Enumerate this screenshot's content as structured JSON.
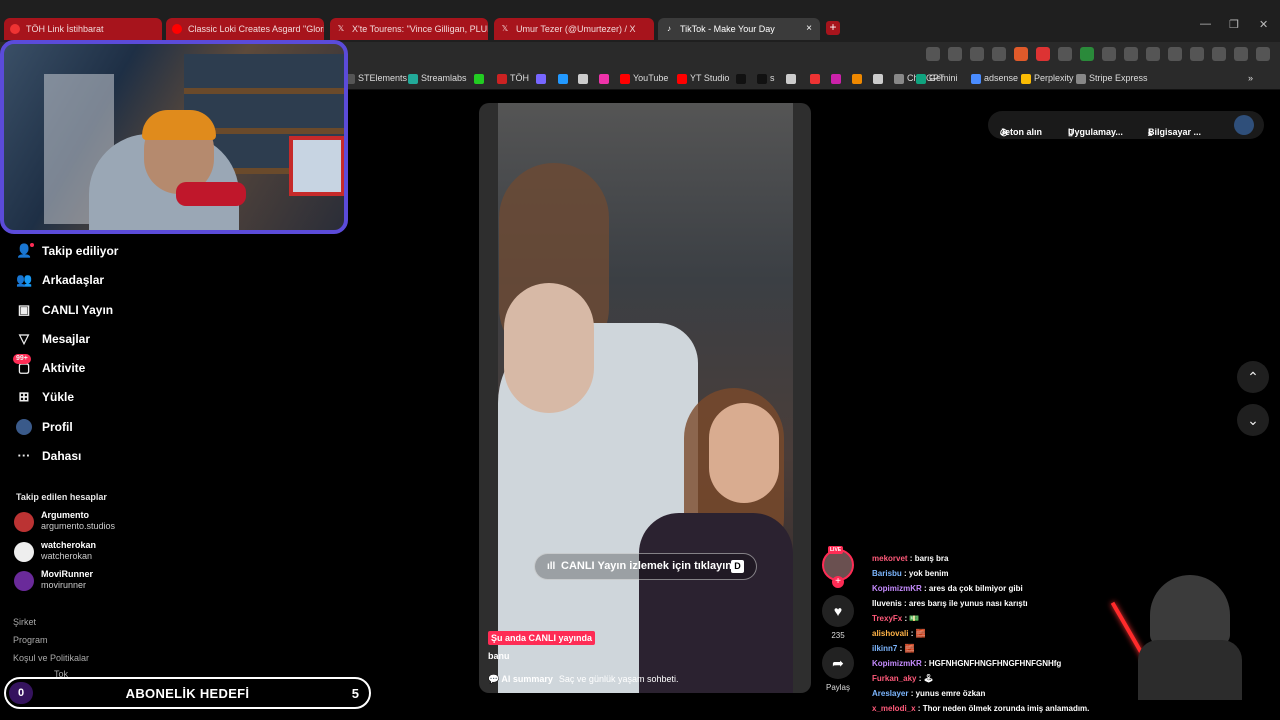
{
  "browser": {
    "tabs": [
      {
        "title": "TÖH Link İstihbarat",
        "icon": "toh-icon"
      },
      {
        "title": "Classic Loki Creates Asgard \"Glorious",
        "icon": "youtube-icon"
      },
      {
        "title": "X'te Tourens: \"Vince Gilligan, PLURIB",
        "icon": "x-icon"
      },
      {
        "title": "Umur Tezer (@Umurtezer) / X",
        "icon": "x-icon"
      },
      {
        "title": "TikTok - Make Your Day",
        "icon": "tiktok-icon"
      }
    ],
    "active_tab_index": 4,
    "new_tab_label": "+",
    "close_label": "×",
    "bookmarks": [
      "STElements",
      "Streamlabs",
      "",
      "TÖH",
      "",
      "",
      "",
      "",
      "YouTube",
      "YT Studio",
      "",
      "s",
      "",
      "",
      "",
      "",
      "",
      "ChatGPT",
      "Gemini",
      "adsense",
      "Perplexity",
      "Stripe Express"
    ],
    "bookmarks_more": "»"
  },
  "sidebar": {
    "nav": [
      {
        "label": "Takip ediliyor",
        "icon": "following-icon"
      },
      {
        "label": "Arkadaşlar",
        "icon": "friends-icon"
      },
      {
        "label": "CANLI Yayın",
        "icon": "live-icon"
      },
      {
        "label": "Mesajlar",
        "icon": "messages-icon"
      },
      {
        "label": "Aktivite",
        "icon": "activity-icon",
        "badge": "99+"
      },
      {
        "label": "Yükle",
        "icon": "upload-icon"
      },
      {
        "label": "Profil",
        "icon": "profile-icon"
      },
      {
        "label": "Dahası",
        "icon": "more-icon"
      }
    ],
    "following_heading": "Takip edilen hesaplar",
    "following": [
      {
        "name": "Argumento",
        "handle": "argumento.studios"
      },
      {
        "name": "watcherokan",
        "handle": "watcherokan"
      },
      {
        "name": "MoviRunner",
        "handle": "movirunner"
      }
    ],
    "footer": [
      "Şirket",
      "Program",
      "Koşul ve Politikalar"
    ],
    "footer_tail": "Tok"
  },
  "overlay": {
    "goal_count_left": "0",
    "goal_title": "ABONELİK HEDEFİ",
    "goal_count_right": "5"
  },
  "live": {
    "cta": "CANLI Yayın izlemek için tıklayın",
    "cta_key": "D",
    "live_tag": "Şu anda CANLI yayında",
    "streamer": "banu",
    "ai_label": "AI summary",
    "ai_text": "Saç ve günlük yaşam sohbeti.",
    "avatar_badge": "LIVE",
    "likes": "235",
    "share_label": "Paylaş"
  },
  "header_right": {
    "coins": "Jeton alın",
    "app": "Uygulamay...",
    "desktop": "Bilgisayar ..."
  },
  "chat": [
    {
      "user": "mekorvet",
      "text": "barış bra",
      "color": "#ff5a7a"
    },
    {
      "user": "Barisbu",
      "text": "yok benim",
      "color": "#7db7ff"
    },
    {
      "user": "KopimizmKR",
      "text": "ares da çok bilmiyor gibi",
      "color": "#c68cff"
    },
    {
      "user": "Iluvenis",
      "text": "ares barış ile yunus nası karıştı",
      "color": "#ffffff"
    },
    {
      "user": "TrexyFx",
      "text": "💵",
      "color": "#ff5a7a"
    },
    {
      "user": "alishovali",
      "text": "🧱",
      "color": "#ffb347"
    },
    {
      "user": "ilkinn7",
      "text": "🧱",
      "color": "#7db7ff"
    },
    {
      "user": "KopimizmKR",
      "text": "HGFNHGNFHNGFHNGFHNFGNHfg",
      "color": "#c68cff"
    },
    {
      "user": "Furkan_aky",
      "text": "🕹",
      "color": "#ff5a7a"
    },
    {
      "user": "Areslayer",
      "text": "yunus emre özkan",
      "color": "#7db7ff"
    },
    {
      "user": "x_melodi_x",
      "text": "Thor neden ölmek zorunda imiş anlamadım.",
      "color": "#ff5a7a"
    }
  ]
}
